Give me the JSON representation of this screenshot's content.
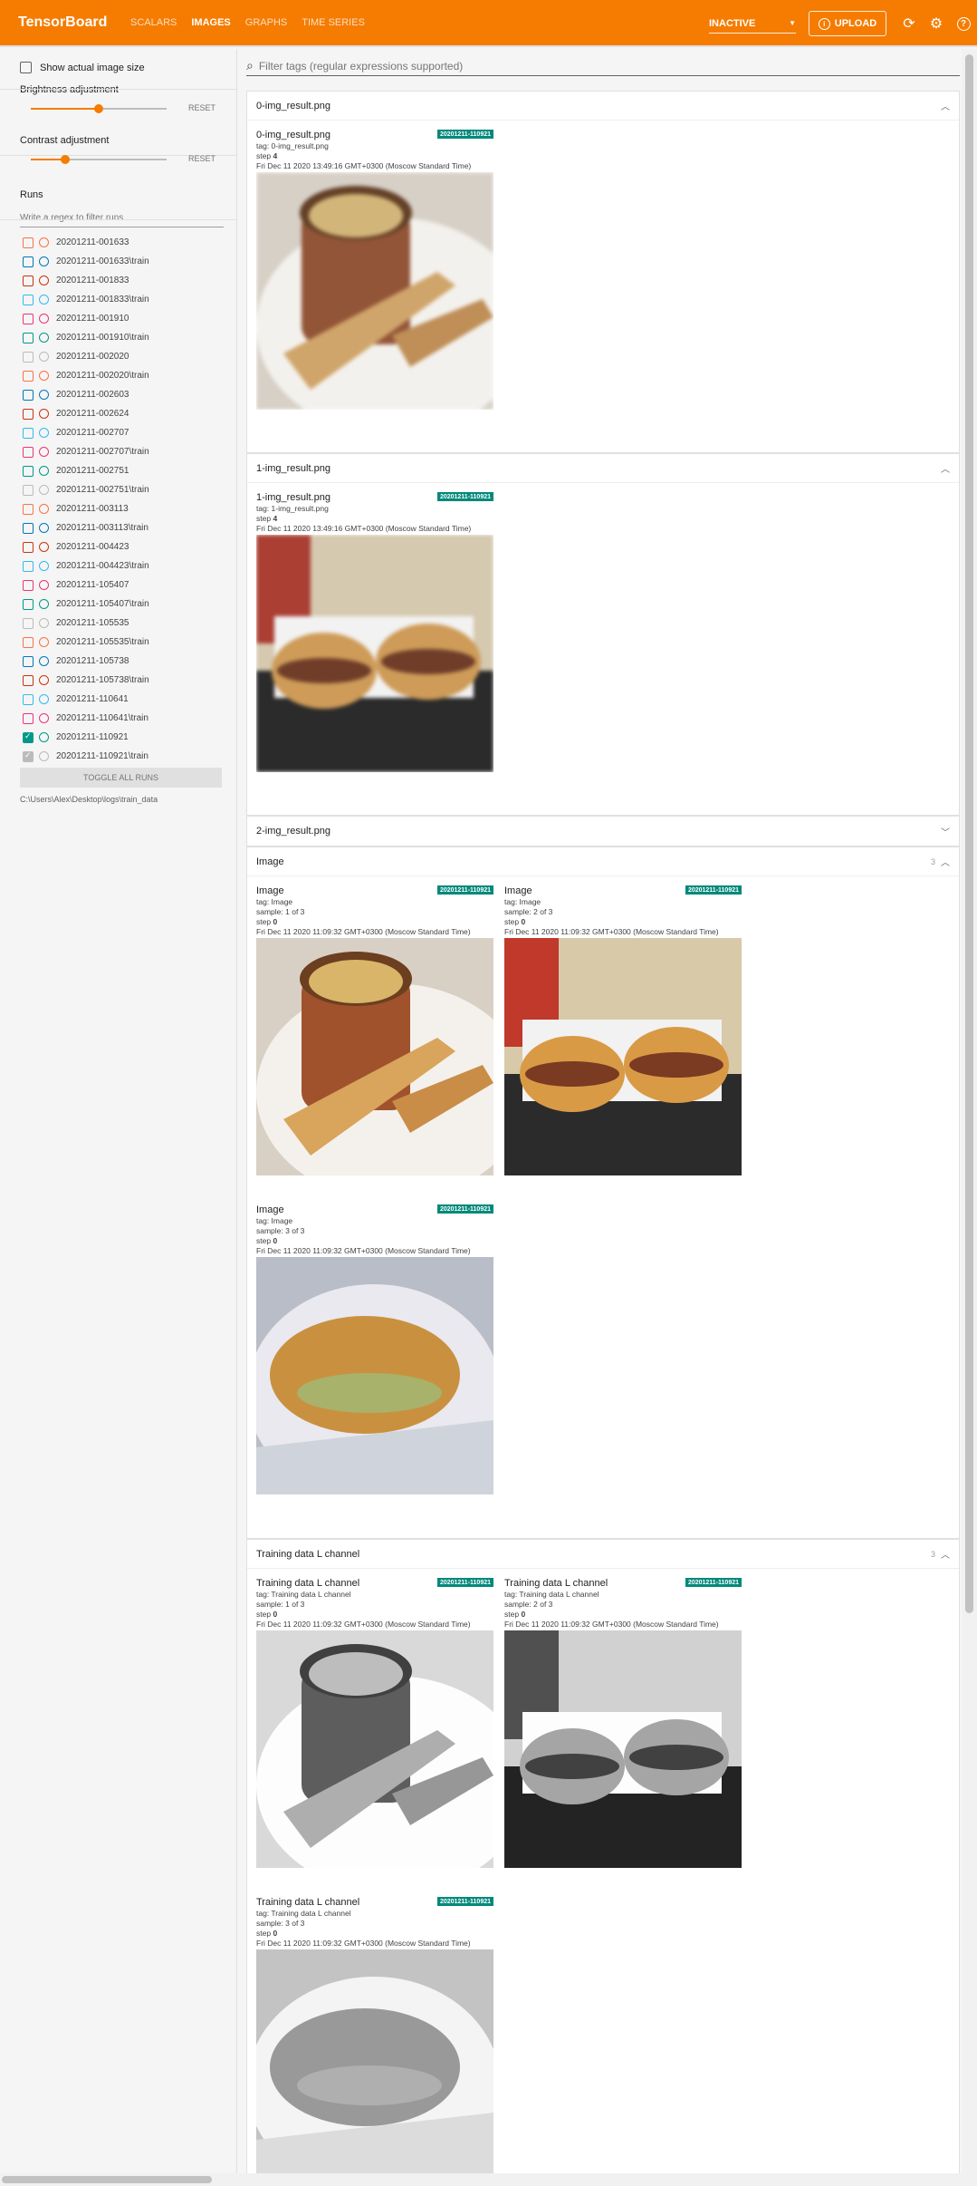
{
  "app": {
    "title": "TensorBoard"
  },
  "nav": {
    "tabs": [
      {
        "label": "SCALARS",
        "active": false
      },
      {
        "label": "IMAGES",
        "active": true
      },
      {
        "label": "GRAPHS",
        "active": false
      },
      {
        "label": "TIME SERIES",
        "active": false
      }
    ]
  },
  "toolbar": {
    "mode": "INACTIVE",
    "upload": "UPLOAD",
    "icons": [
      "refresh-icon",
      "settings-icon",
      "help-icon"
    ]
  },
  "colors": {
    "accent": "#f57c00",
    "chip": "#00897b"
  },
  "sidebar": {
    "show_actual_size": "Show actual image size",
    "brightness": {
      "label": "Brightness adjustment",
      "reset": "RESET",
      "level": 0.5
    },
    "contrast": {
      "label": "Contrast adjustment",
      "reset": "RESET",
      "level": 0.25
    },
    "runs_title": "Runs",
    "runs_filter_placeholder": "Write a regex to filter runs",
    "runs": [
      {
        "name": "20201211-001633",
        "color": "#ff7043",
        "checked": false
      },
      {
        "name": "20201211-001633\\train",
        "color": "#0077bb",
        "checked": false
      },
      {
        "name": "20201211-001833",
        "color": "#cc3311",
        "checked": false
      },
      {
        "name": "20201211-001833\\train",
        "color": "#33bbee",
        "checked": false
      },
      {
        "name": "20201211-001910",
        "color": "#ee3377",
        "checked": false
      },
      {
        "name": "20201211-001910\\train",
        "color": "#009988",
        "checked": false
      },
      {
        "name": "20201211-002020",
        "color": "#bbbbbb",
        "checked": false
      },
      {
        "name": "20201211-002020\\train",
        "color": "#ff7043",
        "checked": false
      },
      {
        "name": "20201211-002603",
        "color": "#0077bb",
        "checked": false
      },
      {
        "name": "20201211-002624",
        "color": "#cc3311",
        "checked": false
      },
      {
        "name": "20201211-002707",
        "color": "#33bbee",
        "checked": false
      },
      {
        "name": "20201211-002707\\train",
        "color": "#ee3377",
        "checked": false
      },
      {
        "name": "20201211-002751",
        "color": "#009988",
        "checked": false
      },
      {
        "name": "20201211-002751\\train",
        "color": "#bbbbbb",
        "checked": false
      },
      {
        "name": "20201211-003113",
        "color": "#ff7043",
        "checked": false
      },
      {
        "name": "20201211-003113\\train",
        "color": "#0077bb",
        "checked": false
      },
      {
        "name": "20201211-004423",
        "color": "#cc3311",
        "checked": false
      },
      {
        "name": "20201211-004423\\train",
        "color": "#33bbee",
        "checked": false
      },
      {
        "name": "20201211-105407",
        "color": "#ee3377",
        "checked": false
      },
      {
        "name": "20201211-105407\\train",
        "color": "#009988",
        "checked": false
      },
      {
        "name": "20201211-105535",
        "color": "#bbbbbb",
        "checked": false
      },
      {
        "name": "20201211-105535\\train",
        "color": "#ff7043",
        "checked": false
      },
      {
        "name": "20201211-105738",
        "color": "#0077bb",
        "checked": false
      },
      {
        "name": "20201211-105738\\train",
        "color": "#cc3311",
        "checked": false
      },
      {
        "name": "20201211-110641",
        "color": "#33bbee",
        "checked": false
      },
      {
        "name": "20201211-110641\\train",
        "color": "#ee3377",
        "checked": false
      },
      {
        "name": "20201211-110921",
        "color": "#009988",
        "checked": true
      },
      {
        "name": "20201211-110921\\train",
        "color": "#bbbbbb",
        "checked": true
      }
    ],
    "toggle_all": "TOGGLE ALL RUNS",
    "logdir": "C:\\Users\\Alex\\Desktop\\logs\\train_data"
  },
  "main": {
    "filter_placeholder": "Filter tags (regular expressions supported)",
    "cards": [
      {
        "title": "0-img_result.png",
        "count": "",
        "expanded": true,
        "tiles": [
          {
            "title": "0-img_result.png",
            "run": "20201211-110921",
            "tag": "tag: 0-img_result.png",
            "sample": "",
            "step_label": "step",
            "step": "4",
            "time": "Fri Dec 11 2020 13:49:16 GMT+0300 (Moscow Standard Time)",
            "image": "soup-blurry"
          }
        ]
      },
      {
        "title": "1-img_result.png",
        "count": "",
        "expanded": true,
        "tiles": [
          {
            "title": "1-img_result.png",
            "run": "20201211-110921",
            "tag": "tag: 1-img_result.png",
            "sample": "",
            "step_label": "step",
            "step": "4",
            "time": "Fri Dec 11 2020 13:49:16 GMT+0300 (Moscow Standard Time)",
            "image": "burger-blurry"
          }
        ]
      },
      {
        "title": "2-img_result.png",
        "count": "",
        "expanded": false,
        "tiles": []
      },
      {
        "title": "Image",
        "count": "3",
        "expanded": true,
        "tiles": [
          {
            "title": "Image",
            "run": "20201211-110921",
            "tag": "tag: Image",
            "sample": "sample: 1 of 3",
            "step_label": "step",
            "step": "0",
            "time": "Fri Dec 11 2020 11:09:32 GMT+0300 (Moscow Standard Time)",
            "image": "soup"
          },
          {
            "title": "Image",
            "run": "20201211-110921",
            "tag": "tag: Image",
            "sample": "sample: 2 of 3",
            "step_label": "step",
            "step": "0",
            "time": "Fri Dec 11 2020 11:09:32 GMT+0300 (Moscow Standard Time)",
            "image": "burger"
          },
          {
            "title": "Image",
            "run": "20201211-110921",
            "tag": "tag: Image",
            "sample": "sample: 3 of 3",
            "step_label": "step",
            "step": "0",
            "time": "Fri Dec 11 2020 11:09:32 GMT+0300 (Moscow Standard Time)",
            "image": "wrap"
          }
        ]
      },
      {
        "title": "Training data L channel",
        "count": "3",
        "expanded": true,
        "tiles": [
          {
            "title": "Training data L channel",
            "run": "20201211-110921",
            "tag": "tag: Training data L channel",
            "sample": "sample: 1 of 3",
            "step_label": "step",
            "step": "0",
            "time": "Fri Dec 11 2020 11:09:32 GMT+0300 (Moscow Standard Time)",
            "image": "soup-gray"
          },
          {
            "title": "Training data L channel",
            "run": "20201211-110921",
            "tag": "tag: Training data L channel",
            "sample": "sample: 2 of 3",
            "step_label": "step",
            "step": "0",
            "time": "Fri Dec 11 2020 11:09:32 GMT+0300 (Moscow Standard Time)",
            "image": "burger-gray"
          },
          {
            "title": "Training data L channel",
            "run": "20201211-110921",
            "tag": "tag: Training data L channel",
            "sample": "sample: 3 of 3",
            "step_label": "step",
            "step": "0",
            "time": "Fri Dec 11 2020 11:09:32 GMT+0300 (Moscow Standard Time)",
            "image": "wrap-gray"
          }
        ]
      }
    ]
  }
}
